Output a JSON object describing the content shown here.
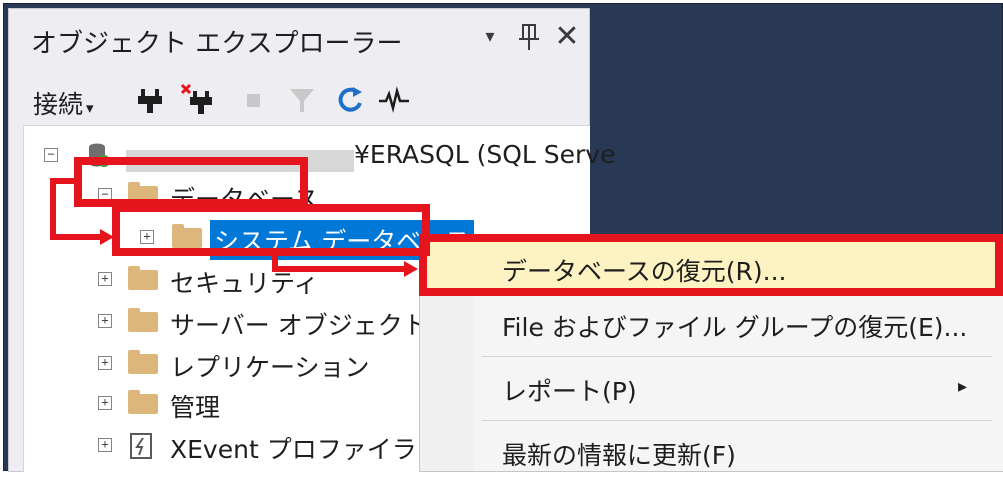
{
  "panel": {
    "title": "オブジェクト エクスプローラー",
    "dropdown_glyph": "▾",
    "pin_glyph": "ꟷ",
    "close_glyph": "✕"
  },
  "toolbar": {
    "connect_label": "接続",
    "connect_arrow": "▾",
    "icons": [
      "connect-plug-icon",
      "disconnect-plug-icon",
      "stop-icon",
      "filter-icon",
      "refresh-icon",
      "activity-monitor-icon"
    ]
  },
  "tree": {
    "server_suffix": "¥ERASQL (SQL Serve",
    "items": [
      {
        "label": "データベース",
        "expander": "⊟"
      },
      {
        "label": "システム データベース",
        "expander": "+"
      },
      {
        "label": "セキュリティ",
        "expander": "+"
      },
      {
        "label": "サーバー オブジェクト",
        "expander": "+"
      },
      {
        "label": "レプリケーション",
        "expander": "+"
      },
      {
        "label": "管理",
        "expander": "+"
      },
      {
        "label": "XEvent プロファイラー",
        "expander": "+"
      }
    ]
  },
  "context_menu": {
    "items": [
      {
        "label": "データベースの復元(R)..."
      },
      {
        "label": "File およびファイル グループの復元(E)..."
      },
      {
        "label": "レポート(P)",
        "submenu_glyph": "▸"
      },
      {
        "label": "最新の情報に更新(F)"
      }
    ]
  },
  "colors": {
    "frame": "#293955",
    "panel": "#eeeef2",
    "selection": "#0078d7",
    "menu_highlight": "#fdf3c2",
    "annotation_red": "#e6141c",
    "folder": "#dcb67a"
  }
}
